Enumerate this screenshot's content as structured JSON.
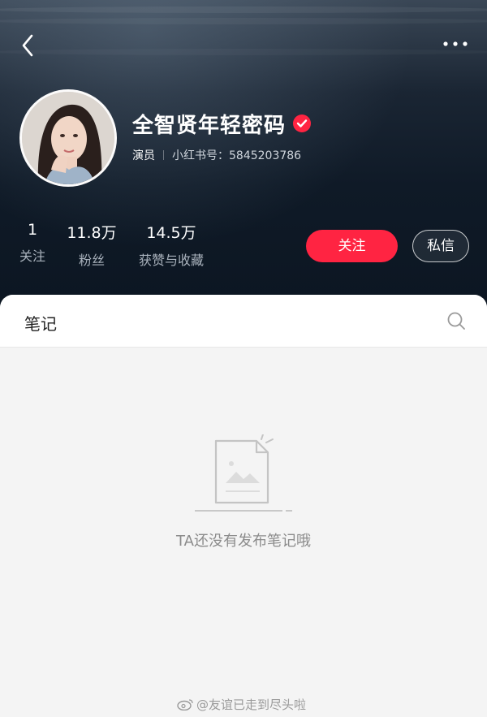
{
  "header": {
    "back_icon": "chevron-left-icon",
    "more_icon": "more-horizontal-icon"
  },
  "profile": {
    "name": "全智贤年轻密码",
    "verified_icon": "verified-badge-icon",
    "role": "演员",
    "id_text": "小红书号：5845203786"
  },
  "stats": [
    {
      "value": "1",
      "label": "关注"
    },
    {
      "value": "11.8万",
      "label": "粉丝"
    },
    {
      "value": "14.5万",
      "label": "获赞与收藏"
    }
  ],
  "actions": {
    "follow_label": "关注",
    "message_label": "私信"
  },
  "tabs": {
    "notes_label": "笔记"
  },
  "empty_state": {
    "text": "TA还没有发布笔记哦"
  },
  "watermark": {
    "text": "@友谊已走到尽头啦"
  },
  "colors": {
    "accent": "#ff2442",
    "hero_bg": "#0f1a27",
    "panel_bg": "#f4f4f4"
  }
}
